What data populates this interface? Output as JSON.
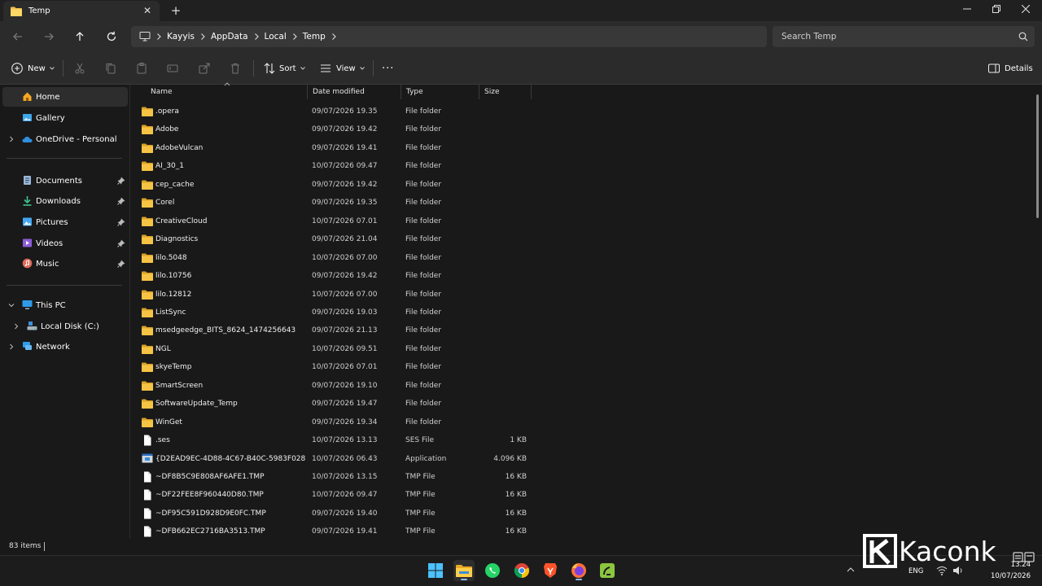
{
  "window": {
    "tab_title": "Temp",
    "new_tab_symbol": "+",
    "close_tab_symbol": "✕"
  },
  "address": {
    "breadcrumb": [
      "Kayyis",
      "AppData",
      "Local",
      "Temp"
    ],
    "search_placeholder": "Search Temp"
  },
  "toolbar": {
    "new_label": "New",
    "sort_label": "Sort",
    "view_label": "View",
    "more_label": "···",
    "details_label": "Details"
  },
  "sidebar": {
    "home": "Home",
    "gallery": "Gallery",
    "onedrive": "OneDrive - Personal",
    "documents": "Documents",
    "downloads": "Downloads",
    "pictures": "Pictures",
    "videos": "Videos",
    "music": "Music",
    "this_pc": "This PC",
    "local_disk": "Local Disk (C:)",
    "network": "Network"
  },
  "columns": {
    "name": "Name",
    "date": "Date modified",
    "type": "Type",
    "size": "Size"
  },
  "files": [
    {
      "name": ".opera",
      "date": "09/07/2026 19.35",
      "type": "File folder",
      "size": "",
      "kind": "folder"
    },
    {
      "name": "Adobe",
      "date": "09/07/2026 19.42",
      "type": "File folder",
      "size": "",
      "kind": "folder"
    },
    {
      "name": "AdobeVulcan",
      "date": "09/07/2026 19.41",
      "type": "File folder",
      "size": "",
      "kind": "folder"
    },
    {
      "name": "AI_30_1",
      "date": "10/07/2026 09.47",
      "type": "File folder",
      "size": "",
      "kind": "folder"
    },
    {
      "name": "cep_cache",
      "date": "09/07/2026 19.42",
      "type": "File folder",
      "size": "",
      "kind": "folder"
    },
    {
      "name": "Corel",
      "date": "09/07/2026 19.35",
      "type": "File folder",
      "size": "",
      "kind": "folder"
    },
    {
      "name": "CreativeCloud",
      "date": "10/07/2026 07.01",
      "type": "File folder",
      "size": "",
      "kind": "folder"
    },
    {
      "name": "Diagnostics",
      "date": "09/07/2026 21.04",
      "type": "File folder",
      "size": "",
      "kind": "folder"
    },
    {
      "name": "lilo.5048",
      "date": "10/07/2026 07.00",
      "type": "File folder",
      "size": "",
      "kind": "folder"
    },
    {
      "name": "lilo.10756",
      "date": "09/07/2026 19.42",
      "type": "File folder",
      "size": "",
      "kind": "folder"
    },
    {
      "name": "lilo.12812",
      "date": "10/07/2026 07.00",
      "type": "File folder",
      "size": "",
      "kind": "folder"
    },
    {
      "name": "ListSync",
      "date": "09/07/2026 19.03",
      "type": "File folder",
      "size": "",
      "kind": "folder"
    },
    {
      "name": "msedgeedge_BITS_8624_1474256643",
      "date": "09/07/2026 21.13",
      "type": "File folder",
      "size": "",
      "kind": "folder"
    },
    {
      "name": "NGL",
      "date": "10/07/2026 09.51",
      "type": "File folder",
      "size": "",
      "kind": "folder"
    },
    {
      "name": "skyeTemp",
      "date": "10/07/2026 07.01",
      "type": "File folder",
      "size": "",
      "kind": "folder"
    },
    {
      "name": "SmartScreen",
      "date": "09/07/2026 19.10",
      "type": "File folder",
      "size": "",
      "kind": "folder"
    },
    {
      "name": "SoftwareUpdate_Temp",
      "date": "09/07/2026 19.47",
      "type": "File folder",
      "size": "",
      "kind": "folder"
    },
    {
      "name": "WinGet",
      "date": "09/07/2026 19.34",
      "type": "File folder",
      "size": "",
      "kind": "folder"
    },
    {
      "name": ".ses",
      "date": "10/07/2026 13.13",
      "type": "SES File",
      "size": "1 KB",
      "kind": "file"
    },
    {
      "name": "{D2EAD9EC-4D88-4C67-B40C-5983F0281…",
      "date": "10/07/2026 06.43",
      "type": "Application",
      "size": "4.096 KB",
      "kind": "app"
    },
    {
      "name": "~DF8B5C9E808AF6AFE1.TMP",
      "date": "10/07/2026 13.15",
      "type": "TMP File",
      "size": "16 KB",
      "kind": "file"
    },
    {
      "name": "~DF22FEE8F960440D80.TMP",
      "date": "10/07/2026 09.47",
      "type": "TMP File",
      "size": "16 KB",
      "kind": "file"
    },
    {
      "name": "~DF95C591D928D9E0FC.TMP",
      "date": "09/07/2026 19.40",
      "type": "TMP File",
      "size": "16 KB",
      "kind": "file"
    },
    {
      "name": "~DFB662EC2716BA3513.TMP",
      "date": "09/07/2026 19.41",
      "type": "TMP File",
      "size": "16 KB",
      "kind": "file"
    }
  ],
  "status": {
    "item_count": "83 items"
  },
  "tray": {
    "language": "ENG",
    "time": "13.24",
    "date": "10/07/2026"
  },
  "watermark": {
    "text": "Kaconk"
  },
  "colors": {
    "folder": "#f2c14e",
    "accent": "#4cc2ff",
    "background": "#191919",
    "chrome": "#2b2b2b"
  }
}
